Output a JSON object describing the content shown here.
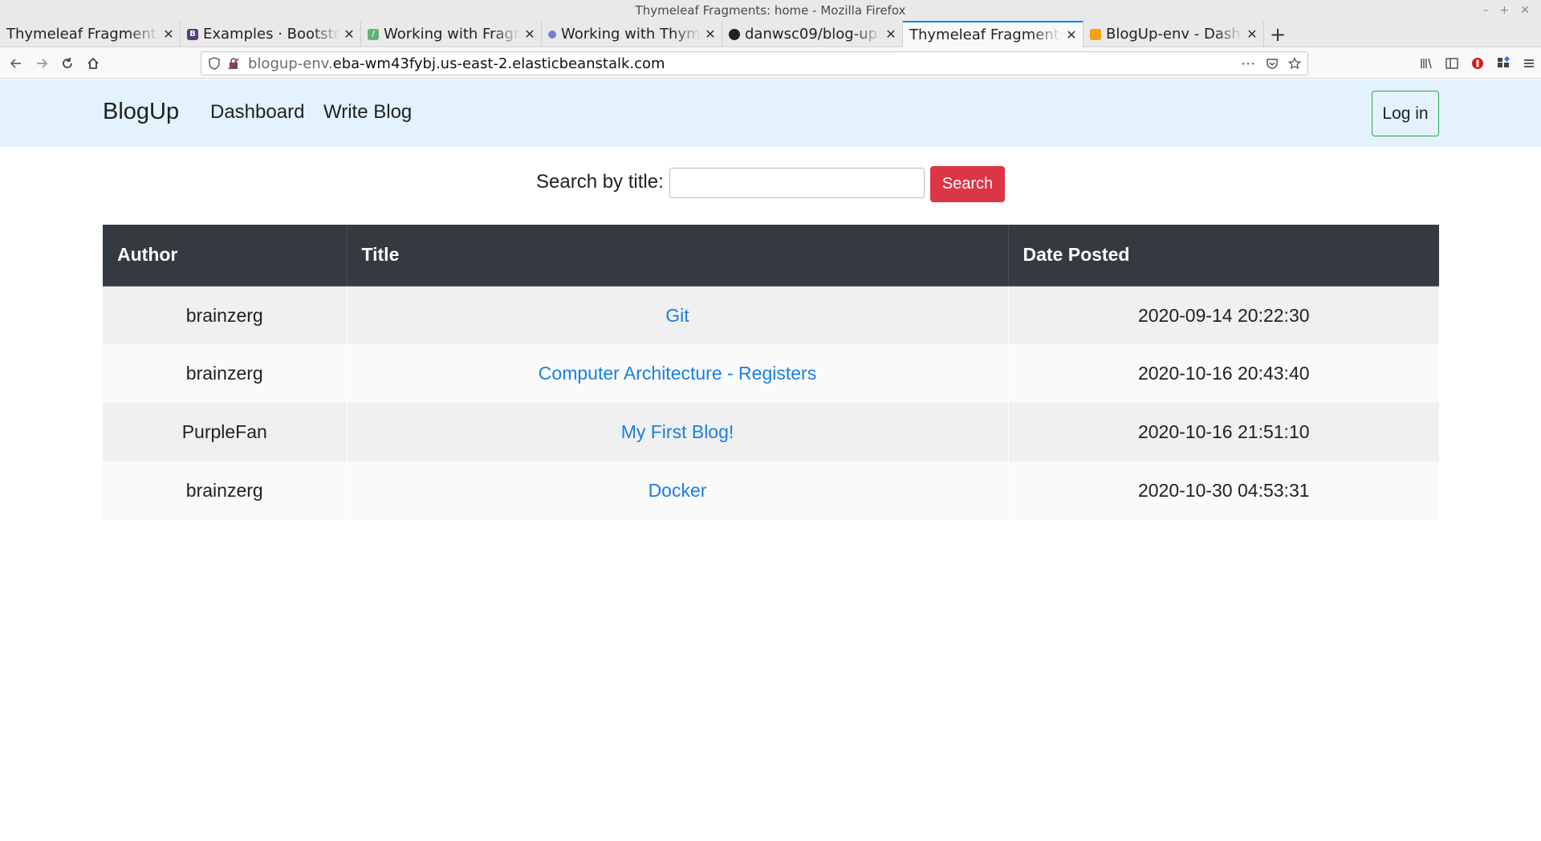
{
  "window": {
    "title": "Thymeleaf Fragments: home - Mozilla Firefox"
  },
  "tabs": [
    {
      "label": "Thymeleaf Fragments",
      "favicon": "thymeleaf-icon",
      "color": "#e9e9e9"
    },
    {
      "label": "Examples · Bootstrap",
      "favicon": "bootstrap-icon",
      "color": "#563d7c"
    },
    {
      "label": "Working with Fragments",
      "favicon": "baeldung-icon",
      "color": "#63b175"
    },
    {
      "label": "Working with Thymeleaf",
      "favicon": "thymeleaf-icon",
      "color": "#7b7bd6"
    },
    {
      "label": "danwsc09/blog-up",
      "favicon": "github-icon",
      "color": "#222222"
    },
    {
      "label": "Thymeleaf Fragments",
      "favicon": "",
      "color": ""
    },
    {
      "label": "BlogUp-env - Dashboard",
      "favicon": "aws-icon",
      "color": "#f0a30a"
    }
  ],
  "active_tab_index": 5,
  "address": {
    "prefix": "blogup-env.",
    "domain": "eba-wm43fybj.us-east-2.elasticbeanstalk.com"
  },
  "site": {
    "brand": "BlogUp",
    "nav": [
      "Dashboard",
      "Write Blog"
    ],
    "login_label": "Log in"
  },
  "search": {
    "label": "Search by title:",
    "value": "",
    "button_label": "Search"
  },
  "table": {
    "headers": [
      "Author",
      "Title",
      "Date Posted"
    ],
    "rows": [
      {
        "author": "brainzerg",
        "title": "Git",
        "date": "2020-09-14 20:22:30"
      },
      {
        "author": "brainzerg",
        "title": "Computer Architecture - Registers",
        "date": "2020-10-16 20:43:40"
      },
      {
        "author": "PurpleFan",
        "title": "My First Blog!",
        "date": "2020-10-16 21:51:10"
      },
      {
        "author": "brainzerg",
        "title": "Docker",
        "date": "2020-10-30 04:53:31"
      }
    ]
  },
  "colors": {
    "navbar_bg": "#e3f2fd",
    "table_header_bg": "#343a40",
    "search_button": "#dc3545",
    "login_border": "#28a745",
    "link": "#1a7fe0"
  }
}
